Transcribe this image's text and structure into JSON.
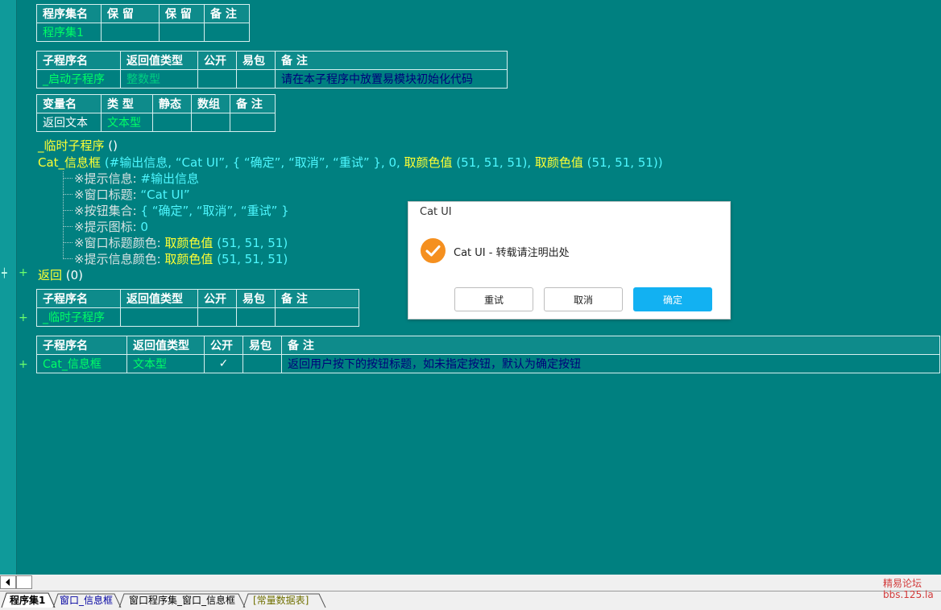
{
  "assembly_table": {
    "headers": [
      "程序集名",
      "保 留",
      "保 留",
      "备 注"
    ],
    "row": [
      "程序集1",
      "",
      "",
      ""
    ]
  },
  "startup_table": {
    "headers": [
      "子程序名",
      "返回值类型",
      "公开",
      "易包",
      "备 注"
    ],
    "row": [
      "_启动子程序",
      "整数型",
      "",
      "",
      "请在本子程序中放置易模块初始化代码"
    ]
  },
  "var_table": {
    "headers": [
      "变量名",
      "类 型",
      "静态",
      "数组",
      "备 注"
    ],
    "row": [
      "返回文本",
      "文本型",
      "",
      "",
      ""
    ]
  },
  "code": {
    "call_temp": "_临时子程序",
    "call_temp_parens": " ()",
    "cat_line": {
      "fn": "Cat_信息框",
      "args_a": " (#输出信息, “Cat UI”, { “确定”, “取消”, “重试” }, 0, ",
      "color_fn": "取颜色值",
      "args_b": " (51, 51, 51), ",
      "args_c": " (51, 51, 51))"
    },
    "params": [
      {
        "label": "※提示信息: ",
        "value": "#输出信息",
        "color_fn": ""
      },
      {
        "label": "※窗口标题: ",
        "value": "“Cat UI”",
        "color_fn": ""
      },
      {
        "label": "※按钮集合: ",
        "value": "{ “确定”, “取消”, “重试” }",
        "color_fn": ""
      },
      {
        "label": "※提示图标: ",
        "value": "0",
        "color_fn": ""
      },
      {
        "label": "※窗口标题颜色: ",
        "value": " (51, 51, 51)",
        "color_fn": "取颜色值"
      },
      {
        "label": "※提示信息颜色: ",
        "value": " (51, 51, 51)",
        "color_fn": "取颜色值"
      }
    ],
    "return_kw": "返回",
    "return_val": " (0)"
  },
  "temp_table": {
    "headers": [
      "子程序名",
      "返回值类型",
      "公开",
      "易包",
      "备 注"
    ],
    "row": [
      "_临时子程序",
      "",
      "",
      "",
      ""
    ]
  },
  "catbox_table": {
    "headers": [
      "子程序名",
      "返回值类型",
      "公开",
      "易包",
      "备 注"
    ],
    "row": [
      "Cat_信息框",
      "文本型",
      "✓",
      "",
      "返回用户按下的按钮标题，如未指定按钮，默认为确定按钮"
    ]
  },
  "gutter": {
    "plus": "+",
    "connector": "┿"
  },
  "dialog": {
    "title": "Cat UI",
    "message": "Cat UI - 转载请注明出处",
    "buttons": [
      "重试",
      "取消",
      "确定"
    ],
    "accent": "#12b1f2",
    "icon_color": "#f5901f",
    "icon": "check-circle-icon"
  },
  "tabs": [
    {
      "label": "程序集1",
      "active": true
    },
    {
      "label": "窗口_信息框",
      "active": false
    },
    {
      "label": "窗口程序集_窗口_信息框",
      "active": false
    },
    {
      "label": "[常量数据表]",
      "active": false
    }
  ],
  "watermark": {
    "line1": "精易论坛",
    "line2": "bbs.125.la"
  }
}
